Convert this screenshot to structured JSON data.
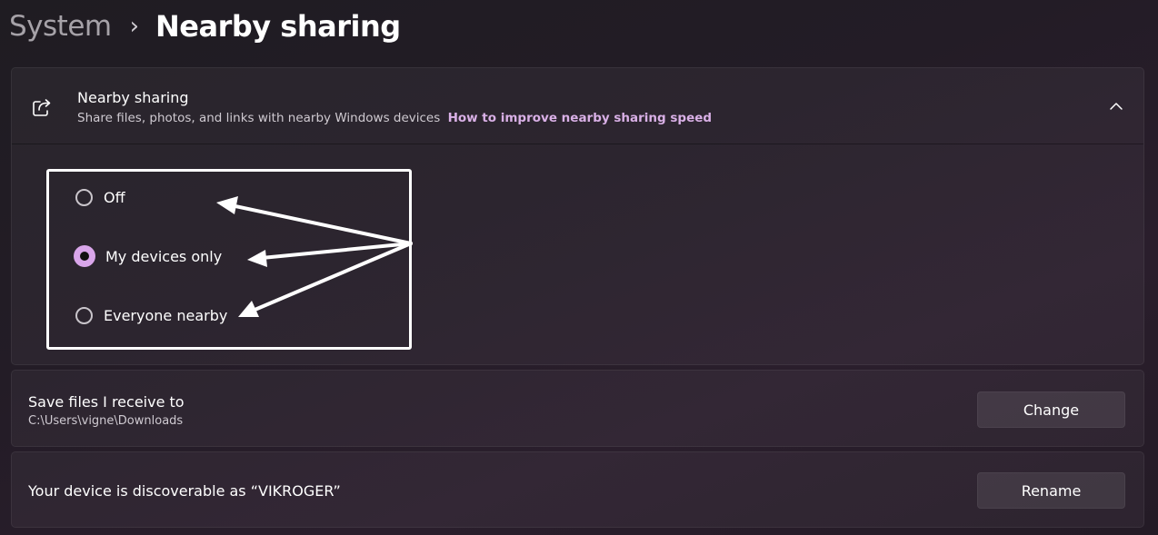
{
  "breadcrumb": {
    "parent": "System",
    "separator": "›",
    "current": "Nearby sharing"
  },
  "nearby_sharing": {
    "icon": "share-icon",
    "title": "Nearby sharing",
    "description": "Share files, photos, and links with nearby Windows devices",
    "link": "How to improve nearby sharing speed",
    "expanded": true,
    "chevron_icon": "chevron-up-icon",
    "options": [
      {
        "label": "Off",
        "selected": false
      },
      {
        "label": "My devices only",
        "selected": true
      },
      {
        "label": "Everyone nearby",
        "selected": false
      }
    ]
  },
  "save_files": {
    "title": "Save files I receive to",
    "path": "C:\\Users\\vigne\\Downloads",
    "button": "Change"
  },
  "discoverable": {
    "title": "Your device is discoverable as “VIKROGER”",
    "button": "Rename"
  },
  "colors": {
    "accent": "#d9a6ea",
    "link": "#d9b0e6",
    "background": "#231c26",
    "annotation": "#ffffff"
  }
}
